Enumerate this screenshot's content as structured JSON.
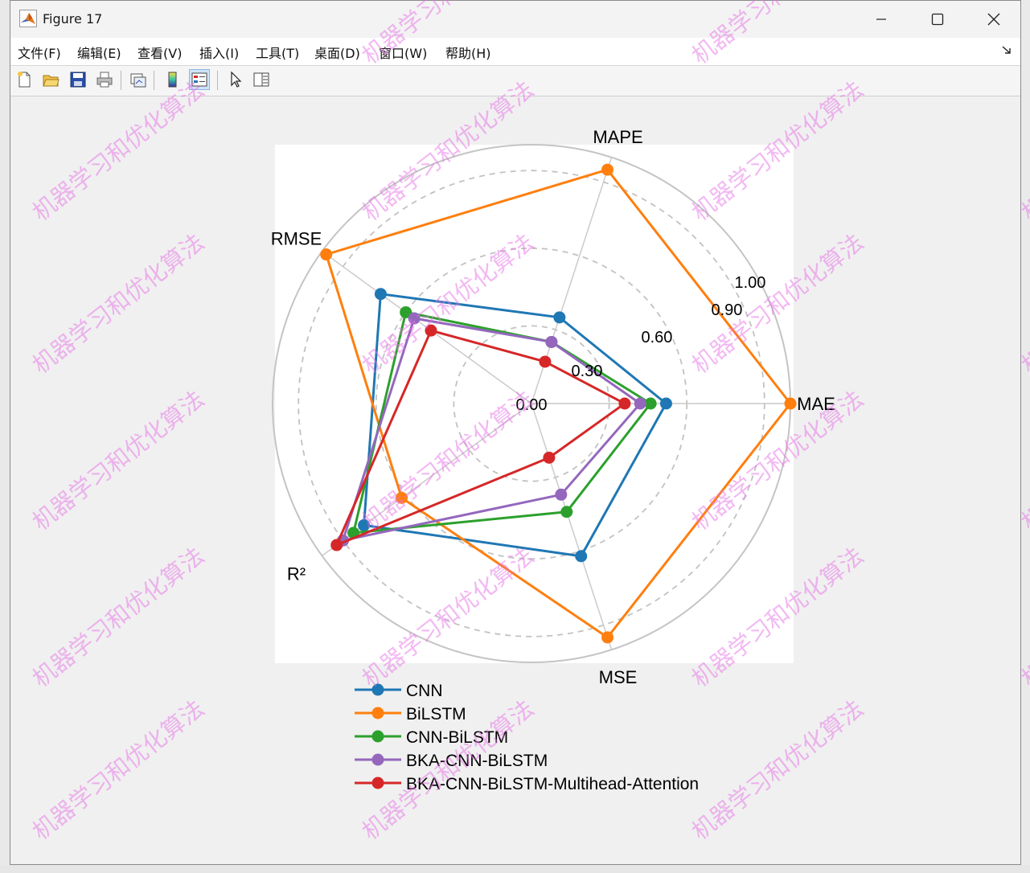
{
  "window": {
    "title": "Figure 17",
    "controls": [
      "minimize",
      "maximize",
      "close"
    ]
  },
  "menubar": {
    "items": [
      {
        "label": "文件(F)"
      },
      {
        "label": "编辑(E)"
      },
      {
        "label": "查看(V)"
      },
      {
        "label": "插入(I)"
      },
      {
        "label": "工具(T)"
      },
      {
        "label": "桌面(D)"
      },
      {
        "label": "窗口(W)"
      },
      {
        "label": "帮助(H)"
      }
    ]
  },
  "toolbar": {
    "buttons": [
      {
        "name": "new-figure-icon"
      },
      {
        "name": "open-file-icon"
      },
      {
        "name": "save-icon"
      },
      {
        "name": "print-icon"
      },
      {
        "name": "link-plot-icon"
      },
      {
        "name": "colorbar-icon"
      },
      {
        "name": "legend-icon",
        "active": true
      },
      {
        "name": "edit-plot-icon"
      },
      {
        "name": "property-inspector-icon"
      }
    ]
  },
  "watermark": {
    "text": "机器学习和优化算法",
    "color": "#e773e7"
  },
  "chart_data": {
    "type": "radar",
    "axes": [
      "MAE",
      "MAPE",
      "RMSE",
      "R²",
      "MSE"
    ],
    "rlim": [
      0,
      1
    ],
    "rtick_labels": [
      "0.00",
      "0.30",
      "0.60",
      "0.90",
      "1.00"
    ],
    "grid": true,
    "legend_position": "bottom",
    "series": [
      {
        "name": "CNN",
        "color": "#1f77b4",
        "values": [
          0.52,
          0.35,
          0.72,
          0.8,
          0.62
        ]
      },
      {
        "name": "BiLSTM",
        "color": "#ff7f0e",
        "values": [
          1.0,
          0.95,
          0.98,
          0.62,
          0.95
        ]
      },
      {
        "name": "CNN-BiLSTM",
        "color": "#2ca02c",
        "values": [
          0.46,
          0.25,
          0.6,
          0.85,
          0.44
        ]
      },
      {
        "name": "BKA-CNN-BiLSTM",
        "color": "#9467bd",
        "values": [
          0.42,
          0.25,
          0.56,
          0.9,
          0.37
        ]
      },
      {
        "name": "BKA-CNN-BiLSTM-Multihead-Attention",
        "color": "#d62728",
        "values": [
          0.36,
          0.17,
          0.48,
          0.93,
          0.22
        ]
      }
    ]
  }
}
